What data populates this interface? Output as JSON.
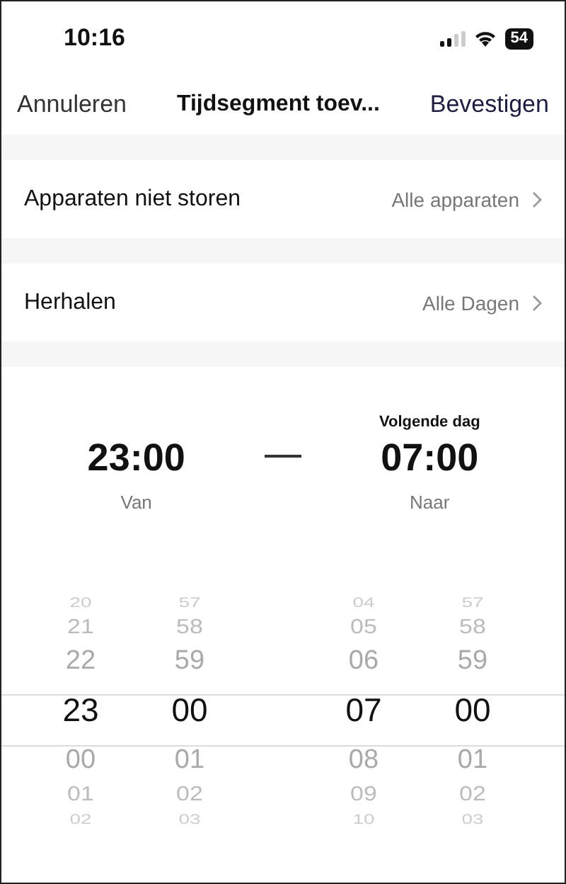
{
  "status_bar": {
    "time": "10:16",
    "battery": "54"
  },
  "nav": {
    "cancel": "Annuleren",
    "title": "Tijdsegment toev...",
    "confirm": "Bevestigen"
  },
  "settings": [
    {
      "label": "Apparaten niet storen",
      "value": "Alle apparaten"
    },
    {
      "label": "Herhalen",
      "value": "Alle Dagen"
    }
  ],
  "range": {
    "start": {
      "time": "23:00",
      "label": "Van"
    },
    "end": {
      "note": "Volgende dag",
      "time": "07:00",
      "label": "Naar"
    }
  },
  "pickers": [
    [
      {
        "value": "20",
        "selected": false
      },
      {
        "value": "21",
        "selected": false
      },
      {
        "value": "22",
        "selected": false
      },
      {
        "value": "23",
        "selected": true
      },
      {
        "value": "00",
        "selected": false
      },
      {
        "value": "01",
        "selected": false
      },
      {
        "value": "02",
        "selected": false
      }
    ],
    [
      {
        "value": "57",
        "selected": false
      },
      {
        "value": "58",
        "selected": false
      },
      {
        "value": "59",
        "selected": false
      },
      {
        "value": "00",
        "selected": true
      },
      {
        "value": "01",
        "selected": false
      },
      {
        "value": "02",
        "selected": false
      },
      {
        "value": "03",
        "selected": false
      }
    ],
    [
      {
        "value": "04",
        "selected": false
      },
      {
        "value": "05",
        "selected": false
      },
      {
        "value": "06",
        "selected": false
      },
      {
        "value": "07",
        "selected": true
      },
      {
        "value": "08",
        "selected": false
      },
      {
        "value": "09",
        "selected": false
      },
      {
        "value": "10",
        "selected": false
      }
    ],
    [
      {
        "value": "57",
        "selected": false
      },
      {
        "value": "58",
        "selected": false
      },
      {
        "value": "59",
        "selected": false
      },
      {
        "value": "00",
        "selected": true
      },
      {
        "value": "01",
        "selected": false
      },
      {
        "value": "02",
        "selected": false
      },
      {
        "value": "03",
        "selected": false
      }
    ]
  ]
}
